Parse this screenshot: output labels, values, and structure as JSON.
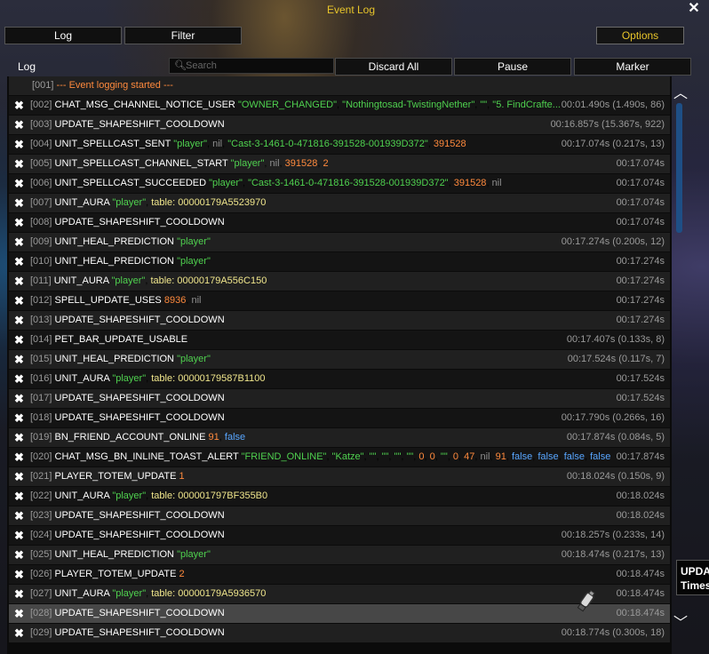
{
  "window": {
    "title": "Event Log"
  },
  "tabs": [
    {
      "label": "Log"
    },
    {
      "label": "Filter"
    }
  ],
  "options_label": "Options",
  "toolbar": {
    "label": "Log",
    "search_placeholder": "Search",
    "discard_all": "Discard All",
    "pause": "Pause",
    "marker": "Marker"
  },
  "log_started": {
    "num": "[001]",
    "text": "--- Event logging started ---"
  },
  "rows": [
    {
      "num": "[002]",
      "event": "CHAT_MSG_CHANNEL_NOTICE_USER",
      "time": "00:01.490s (1.490s, 86)",
      "args": [
        {
          "t": "str",
          "v": "\"OWNER_CHANGED\""
        },
        {
          "t": "str",
          "v": "\"Nothingtosad-TwistingNether\""
        },
        {
          "t": "str",
          "v": "\"\""
        },
        {
          "t": "str",
          "v": "\"5. FindCrafte..."
        }
      ]
    },
    {
      "num": "[003]",
      "event": "UPDATE_SHAPESHIFT_COOLDOWN",
      "time": "00:16.857s (15.367s, 922)",
      "args": []
    },
    {
      "num": "[004]",
      "event": "UNIT_SPELLCAST_SENT",
      "time": "00:17.074s (0.217s, 13)",
      "args": [
        {
          "t": "str",
          "v": "\"player\""
        },
        {
          "t": "nil",
          "v": "nil"
        },
        {
          "t": "str",
          "v": "\"Cast-3-1461-0-471816-391528-001939D372\""
        },
        {
          "t": "num",
          "v": "391528"
        }
      ]
    },
    {
      "num": "[005]",
      "event": "UNIT_SPELLCAST_CHANNEL_START",
      "time": "00:17.074s",
      "args": [
        {
          "t": "str",
          "v": "\"player\""
        },
        {
          "t": "nil",
          "v": "nil"
        },
        {
          "t": "num",
          "v": "391528"
        },
        {
          "t": "num",
          "v": "2"
        }
      ]
    },
    {
      "num": "[006]",
      "event": "UNIT_SPELLCAST_SUCCEEDED",
      "time": "00:17.074s",
      "args": [
        {
          "t": "str",
          "v": "\"player\""
        },
        {
          "t": "str",
          "v": "\"Cast-3-1461-0-471816-391528-001939D372\""
        },
        {
          "t": "num",
          "v": "391528"
        },
        {
          "t": "nil",
          "v": "nil"
        }
      ]
    },
    {
      "num": "[007]",
      "event": "UNIT_AURA",
      "time": "00:17.074s",
      "args": [
        {
          "t": "str",
          "v": "\"player\""
        },
        {
          "t": "tab",
          "v": "table: 00000179A5523970"
        }
      ]
    },
    {
      "num": "[008]",
      "event": "UPDATE_SHAPESHIFT_COOLDOWN",
      "time": "00:17.074s",
      "args": []
    },
    {
      "num": "[009]",
      "event": "UNIT_HEAL_PREDICTION",
      "time": "00:17.274s (0.200s, 12)",
      "args": [
        {
          "t": "str",
          "v": "\"player\""
        }
      ]
    },
    {
      "num": "[010]",
      "event": "UNIT_HEAL_PREDICTION",
      "time": "00:17.274s",
      "args": [
        {
          "t": "str",
          "v": "\"player\""
        }
      ]
    },
    {
      "num": "[011]",
      "event": "UNIT_AURA",
      "time": "00:17.274s",
      "args": [
        {
          "t": "str",
          "v": "\"player\""
        },
        {
          "t": "tab",
          "v": "table: 00000179A556C150"
        }
      ]
    },
    {
      "num": "[012]",
      "event": "SPELL_UPDATE_USES",
      "time": "00:17.274s",
      "args": [
        {
          "t": "num",
          "v": "8936"
        },
        {
          "t": "nil",
          "v": "nil"
        }
      ]
    },
    {
      "num": "[013]",
      "event": "UPDATE_SHAPESHIFT_COOLDOWN",
      "time": "00:17.274s",
      "args": []
    },
    {
      "num": "[014]",
      "event": "PET_BAR_UPDATE_USABLE",
      "time": "00:17.407s (0.133s, 8)",
      "args": []
    },
    {
      "num": "[015]",
      "event": "UNIT_HEAL_PREDICTION",
      "time": "00:17.524s (0.117s, 7)",
      "args": [
        {
          "t": "str",
          "v": "\"player\""
        }
      ]
    },
    {
      "num": "[016]",
      "event": "UNIT_AURA",
      "time": "00:17.524s",
      "args": [
        {
          "t": "str",
          "v": "\"player\""
        },
        {
          "t": "tab",
          "v": "table: 00000179587B1100"
        }
      ]
    },
    {
      "num": "[017]",
      "event": "UPDATE_SHAPESHIFT_COOLDOWN",
      "time": "00:17.524s",
      "args": []
    },
    {
      "num": "[018]",
      "event": "UPDATE_SHAPESHIFT_COOLDOWN",
      "time": "00:17.790s (0.266s, 16)",
      "args": []
    },
    {
      "num": "[019]",
      "event": "BN_FRIEND_ACCOUNT_ONLINE",
      "time": "00:17.874s (0.084s, 5)",
      "args": [
        {
          "t": "num",
          "v": "91"
        },
        {
          "t": "bool",
          "v": "false"
        }
      ]
    },
    {
      "num": "[020]",
      "event": "CHAT_MSG_BN_INLINE_TOAST_ALERT",
      "time": "00:17.874s",
      "args": [
        {
          "t": "str",
          "v": "\"FRIEND_ONLINE\""
        },
        {
          "t": "str",
          "v": "\"Katze\""
        },
        {
          "t": "str",
          "v": "\"\""
        },
        {
          "t": "str",
          "v": "\"\""
        },
        {
          "t": "str",
          "v": "\"\""
        },
        {
          "t": "str",
          "v": "\"\""
        },
        {
          "t": "num",
          "v": "0"
        },
        {
          "t": "num",
          "v": "0"
        },
        {
          "t": "str",
          "v": "\"\""
        },
        {
          "t": "num",
          "v": "0"
        },
        {
          "t": "num",
          "v": "47"
        },
        {
          "t": "nil",
          "v": "nil"
        },
        {
          "t": "num",
          "v": "91"
        },
        {
          "t": "bool",
          "v": "false"
        },
        {
          "t": "bool",
          "v": "false"
        },
        {
          "t": "bool",
          "v": "false"
        },
        {
          "t": "bool",
          "v": "false"
        }
      ]
    },
    {
      "num": "[021]",
      "event": "PLAYER_TOTEM_UPDATE",
      "time": "00:18.024s (0.150s, 9)",
      "args": [
        {
          "t": "num",
          "v": "1"
        }
      ]
    },
    {
      "num": "[022]",
      "event": "UNIT_AURA",
      "time": "00:18.024s",
      "args": [
        {
          "t": "str",
          "v": "\"player\""
        },
        {
          "t": "tab",
          "v": "table: 000001797BF355B0"
        }
      ]
    },
    {
      "num": "[023]",
      "event": "UPDATE_SHAPESHIFT_COOLDOWN",
      "time": "00:18.024s",
      "args": []
    },
    {
      "num": "[024]",
      "event": "UPDATE_SHAPESHIFT_COOLDOWN",
      "time": "00:18.257s (0.233s, 14)",
      "args": []
    },
    {
      "num": "[025]",
      "event": "UNIT_HEAL_PREDICTION",
      "time": "00:18.474s (0.217s, 13)",
      "args": [
        {
          "t": "str",
          "v": "\"player\""
        }
      ]
    },
    {
      "num": "[026]",
      "event": "PLAYER_TOTEM_UPDATE",
      "time": "00:18.474s",
      "args": [
        {
          "t": "num",
          "v": "2"
        }
      ]
    },
    {
      "num": "[027]",
      "event": "UNIT_AURA",
      "time": "00:18.474s",
      "args": [
        {
          "t": "str",
          "v": "\"player\""
        },
        {
          "t": "tab",
          "v": "table: 00000179A5936570"
        }
      ]
    },
    {
      "num": "[028]",
      "event": "UPDATE_SHAPESHIFT_COOLDOWN",
      "time": "00:18.474s",
      "args": [],
      "selected": true
    },
    {
      "num": "[029]",
      "event": "UPDATE_SHAPESHIFT_COOLDOWN",
      "time": "00:18.774s (0.300s, 18)",
      "args": []
    }
  ],
  "tooltip": {
    "line1": "UPDA",
    "line2": "Times"
  },
  "colors": {
    "title": "#e8c52a",
    "string": "#4fd14f",
    "number": "#ff8a3d",
    "nil": "#8f8f8f",
    "table": "#f0e68c",
    "boolean": "#58a6ff",
    "scroll_thumb": "#1e4f86"
  },
  "icons": {
    "remove": "close-x-icon",
    "close": "close-icon",
    "search": "search-icon",
    "scroll_up": "chevron-up-icon",
    "scroll_down": "chevron-down-icon"
  }
}
